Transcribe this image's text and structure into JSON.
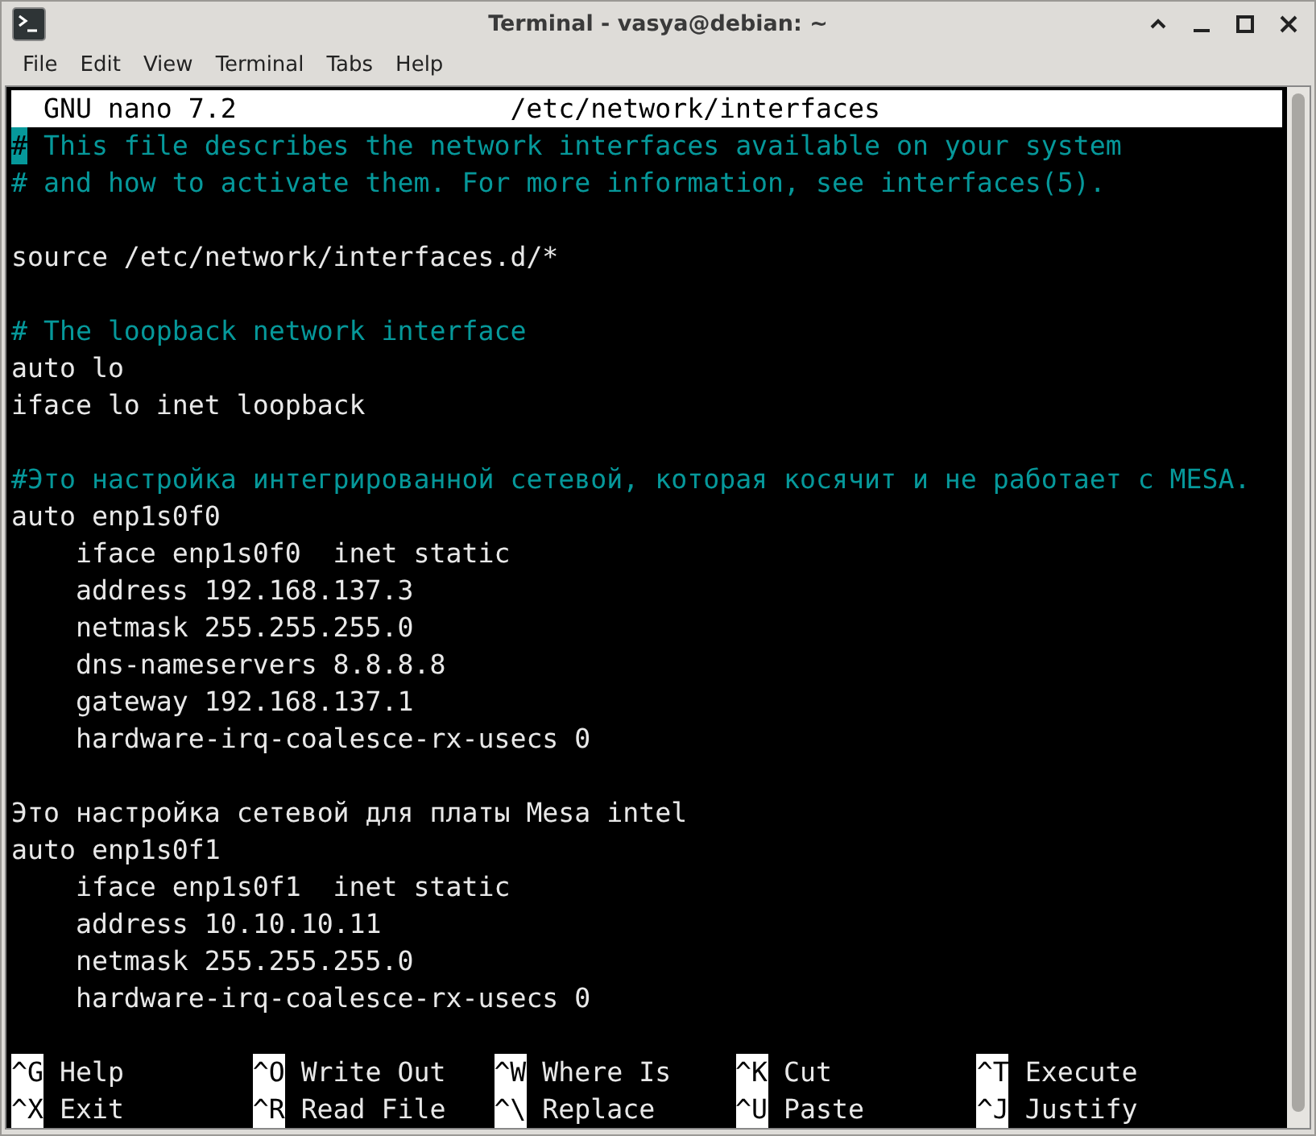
{
  "window": {
    "title": "Terminal - vasya@debian: ~"
  },
  "menu": [
    "File",
    "Edit",
    "View",
    "Terminal",
    "Tabs",
    "Help"
  ],
  "nano": {
    "version": "GNU nano 7.2",
    "filename": "/etc/network/interfaces"
  },
  "editor": {
    "lines": [
      {
        "kind": "comment",
        "text": "# This file describes the network interfaces available on your system",
        "cursor": true
      },
      {
        "kind": "comment",
        "text": "# and how to activate them. For more information, see interfaces(5)."
      },
      {
        "kind": "blank"
      },
      {
        "kind": "text",
        "text": "source /etc/network/interfaces.d/*"
      },
      {
        "kind": "blank"
      },
      {
        "kind": "comment",
        "text": "# The loopback network interface"
      },
      {
        "kind": "text",
        "text": "auto lo"
      },
      {
        "kind": "text",
        "text": "iface lo inet loopback"
      },
      {
        "kind": "blank"
      },
      {
        "kind": "comment",
        "text": "#Это настройка интегрированной сетевой, которая косячит и не работает с MESA."
      },
      {
        "kind": "text",
        "text": "auto enp1s0f0"
      },
      {
        "kind": "text",
        "text": "    iface enp1s0f0  inet static"
      },
      {
        "kind": "text",
        "text": "    address 192.168.137.3"
      },
      {
        "kind": "text",
        "text": "    netmask 255.255.255.0"
      },
      {
        "kind": "text",
        "text": "    dns-nameservers 8.8.8.8"
      },
      {
        "kind": "text",
        "text": "    gateway 192.168.137.1"
      },
      {
        "kind": "text",
        "text": "    hardware-irq-coalesce-rx-usecs 0"
      },
      {
        "kind": "blank"
      },
      {
        "kind": "text",
        "text": "Это настройка сетевой для платы Mesa intel"
      },
      {
        "kind": "text",
        "text": "auto enp1s0f1"
      },
      {
        "kind": "text",
        "text": "    iface enp1s0f1  inet static"
      },
      {
        "kind": "text",
        "text": "    address 10.10.10.11"
      },
      {
        "kind": "text",
        "text": "    netmask 255.255.255.0"
      },
      {
        "kind": "text",
        "text": "    hardware-irq-coalesce-rx-usecs 0"
      }
    ]
  },
  "shortcuts": [
    [
      {
        "key": "^G",
        "label": "Help"
      },
      {
        "key": "^O",
        "label": "Write Out"
      },
      {
        "key": "^W",
        "label": "Where Is"
      },
      {
        "key": "^K",
        "label": "Cut"
      },
      {
        "key": "^T",
        "label": "Execute"
      }
    ],
    [
      {
        "key": "^X",
        "label": "Exit"
      },
      {
        "key": "^R",
        "label": "Read File"
      },
      {
        "key": "^\\",
        "label": "Replace"
      },
      {
        "key": "^U",
        "label": "Paste"
      },
      {
        "key": "^J",
        "label": "Justify"
      }
    ]
  ]
}
